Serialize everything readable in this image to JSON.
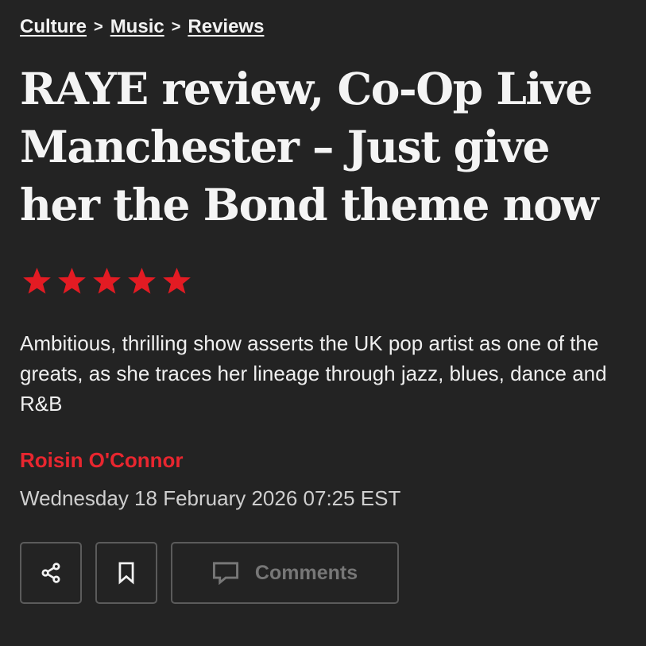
{
  "breadcrumb": {
    "items": [
      "Culture",
      "Music",
      "Reviews"
    ],
    "separator": ">"
  },
  "article": {
    "title": "RAYE review, Co-Op Live Manchester – Just give her the Bond theme now",
    "rating": 5,
    "rating_max": 5,
    "standfirst": "Ambitious, thrilling show asserts the UK pop artist as one of the greats, as she traces her lineage through jazz, blues, dance and R&B",
    "author": "Roisin O'Connor",
    "date": "Wednesday 18 February 2026 07:25 EST"
  },
  "actions": {
    "share_icon": "share-icon",
    "bookmark_icon": "bookmark-icon",
    "comments_icon": "comment-icon",
    "comments_label": "Comments"
  },
  "colors": {
    "background": "#232323",
    "accent": "#e8262f",
    "star": "#e31b23",
    "text": "#f2f2f2",
    "muted": "#777777"
  }
}
